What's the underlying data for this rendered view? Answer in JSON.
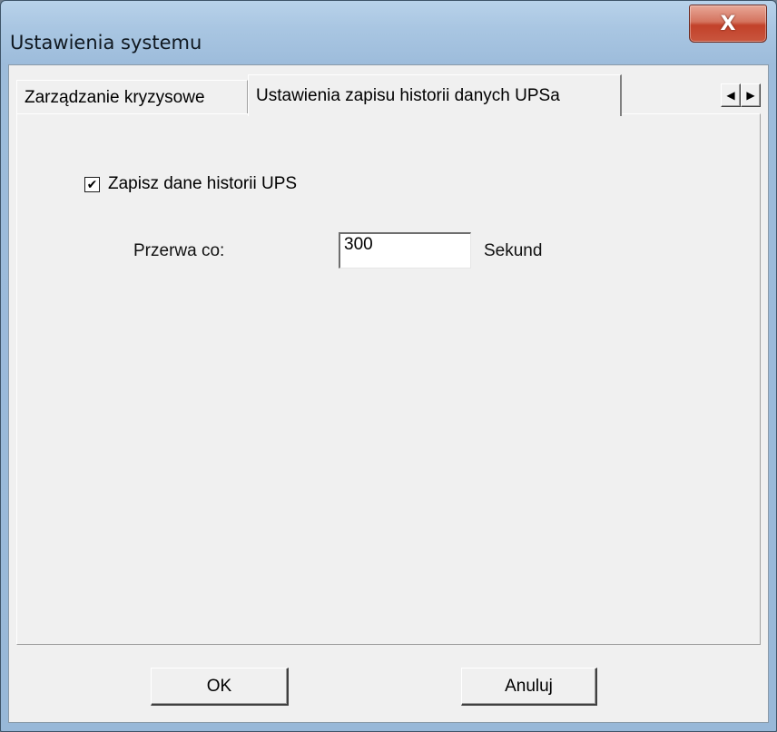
{
  "window": {
    "title": "Ustawienia systemu",
    "close_glyph": "X"
  },
  "tabs": [
    {
      "label": "Zarządzanie kryzysowe",
      "active": false
    },
    {
      "label": "Ustawienia zapisu historii danych UPSa",
      "active": true
    }
  ],
  "tab_scroll": {
    "left": "◀",
    "right": "▶"
  },
  "history": {
    "checkbox_label": "Zapisz dane historii UPS",
    "checkbox_checked": true,
    "checkbox_mark": "✔",
    "interval_label": "Przerwa co:",
    "interval_value": "300",
    "unit_label": "Sekund"
  },
  "buttons": {
    "ok": "OK",
    "cancel": "Anuluj"
  },
  "colors": {
    "close_button": "#c9563e",
    "frame": "#a9c6e2",
    "dialog_bg": "#f0f0f0"
  }
}
